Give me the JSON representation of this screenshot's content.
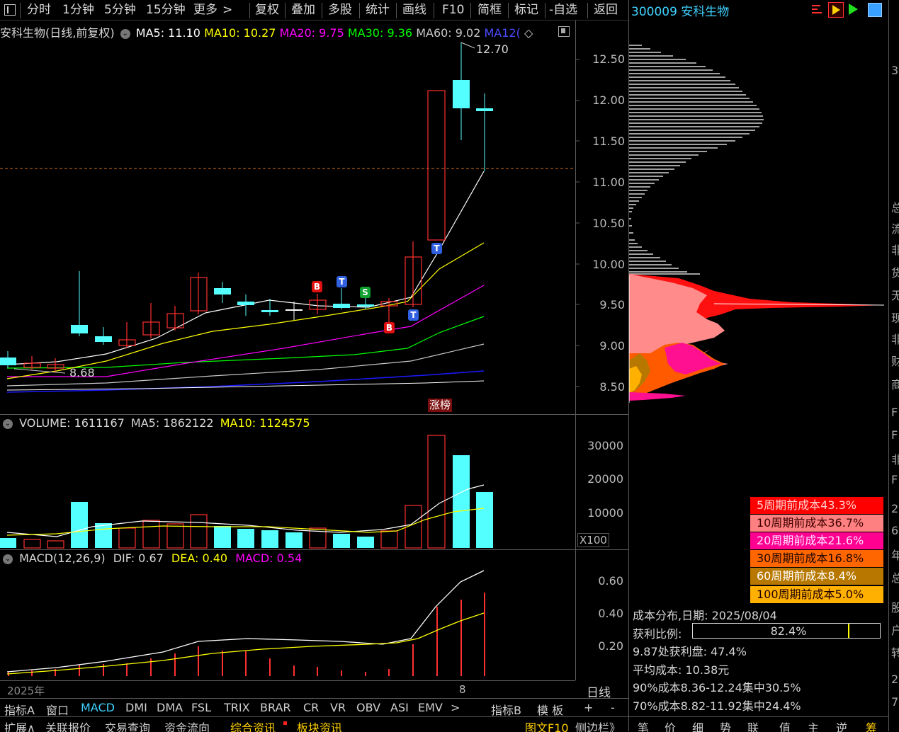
{
  "toolbar": {
    "items": [
      "分时",
      "1分钟",
      "5分钟",
      "15分钟",
      "更多",
      "复权",
      "叠加",
      "多股",
      "统计",
      "画线",
      "F10",
      "简框",
      "标记",
      "-自选",
      "返回"
    ],
    "chevron": ">",
    "stock_code_name": "300009 安科生物"
  },
  "main_chart": {
    "title": "安科生物(日线,前复权)",
    "ma": [
      {
        "label": "MA5: 11.10",
        "color": "#ffffff"
      },
      {
        "label": "MA10: 10.27",
        "color": "#ffff00"
      },
      {
        "label": "MA20: 9.75",
        "color": "#ff00ff"
      },
      {
        "label": "MA30: 9.36",
        "color": "#00ff00"
      },
      {
        "label": "MA60: 9.02",
        "color": "#c8c8c8"
      },
      {
        "label": "MA12(",
        "color": "#4a4aff"
      }
    ],
    "price_ticks": [
      "12.50",
      "12.00",
      "11.50",
      "11.00",
      "10.50",
      "10.00",
      "9.50",
      "9.00",
      "8.50"
    ],
    "high_label": "12.70",
    "low_label": "8.68",
    "zhangbang": "涨榜",
    "markers": [
      "B",
      "T",
      "S",
      "T",
      "B",
      "T"
    ]
  },
  "volume_panel": {
    "title": "VOLUME: 1611167",
    "ma5": "MA5: 1862122",
    "ma10": "MA10: 1124575",
    "ticks": [
      "30000",
      "20000",
      "10000"
    ],
    "unit": "X100"
  },
  "macd_panel": {
    "title": "MACD(12,26,9)",
    "dif": "DIF: 0.67",
    "dea": "DEA: 0.40",
    "macd": "MACD: 0.54",
    "ticks": [
      "0.60",
      "0.40",
      "0.20"
    ],
    "year_label": "2025年",
    "date_label": "8",
    "period": "日线"
  },
  "indicator_tabs": [
    "指标A",
    "窗口",
    "MACD",
    "DMI",
    "DMA",
    "FSL",
    "TRIX",
    "BRAR",
    "CR",
    "VR",
    "OBV",
    "ASI",
    "EMV"
  ],
  "indicator_right": [
    "指标B",
    "模 板",
    "+",
    "-"
  ],
  "bottom_tabs": [
    "扩展∧",
    "关联报价",
    "交易查询",
    "资金流向",
    "综合资讯",
    "板块资讯"
  ],
  "bottom_right": [
    "图文F10",
    "侧边栏》",
    "笔",
    "价",
    "细",
    "势",
    "联",
    "值",
    "主",
    "逆",
    "筹"
  ],
  "cost_distribution": {
    "legend": [
      {
        "label": "5周期前成本43.3%",
        "bg": "#ff0000",
        "fg": "#ffd0d0"
      },
      {
        "label": "10周期前成本36.7%",
        "bg": "#ff8080",
        "fg": "#400000"
      },
      {
        "label": "20周期前成本21.6%",
        "bg": "#ff0090",
        "fg": "#ffe0ff"
      },
      {
        "label": "30周期前成本16.8%",
        "bg": "#ff6600",
        "fg": "#200800"
      },
      {
        "label": "60周期前成本8.4%",
        "bg": "#b87800",
        "fg": "#ffffff"
      },
      {
        "label": "100周期前成本5.0%",
        "bg": "#ffb000",
        "fg": "#200000"
      }
    ],
    "date_line": "成本分布,日期: 2025/08/04",
    "profit_label": "获利比例:",
    "profit_value": "82.4%",
    "profit_ratio": 0.824,
    "profit_at": "9.87处获利盘: 47.4%",
    "avg_cost": "平均成本: 10.38元",
    "c90": "90%成本8.36-12.24集中30.5%",
    "c70": "70%成本8.82-11.92集中24.4%"
  },
  "right_edge_chars": [
    "3",
    "总",
    "流",
    "非",
    "货",
    "无",
    "现",
    "非",
    "财",
    "商",
    "F",
    "F",
    "非",
    "F",
    "2",
    "6",
    "年",
    "总",
    "股",
    "户",
    "转",
    "2",
    "7"
  ]
}
